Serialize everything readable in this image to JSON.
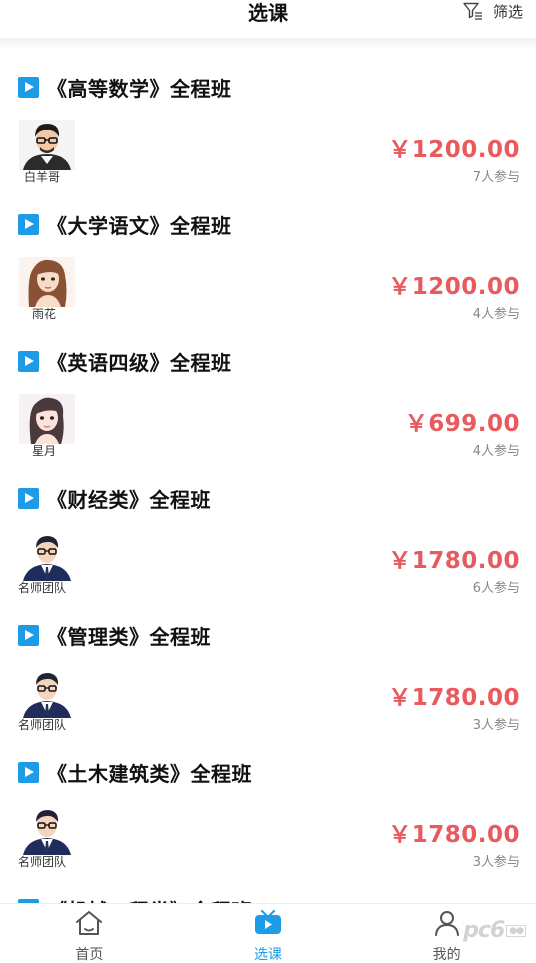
{
  "header": {
    "title": "选课",
    "filter_label": "筛选"
  },
  "courses": [
    {
      "name": "《高等数学》全程班",
      "teacher": "白羊哥",
      "price": "￥1200.00",
      "joined": "7人参与",
      "avatar": "man-glasses"
    },
    {
      "name": "《大学语文》全程班",
      "teacher": "雨花",
      "price": "￥1200.00",
      "joined": "4人参与",
      "avatar": "woman-brown-hair"
    },
    {
      "name": "《英语四级》全程班",
      "teacher": "星月",
      "price": "￥699.00",
      "joined": "4人参与",
      "avatar": "woman-dark-hair"
    },
    {
      "name": "《财经类》全程班",
      "teacher": "名师团队",
      "price": "￥1780.00",
      "joined": "6人参与",
      "avatar": "man-suit"
    },
    {
      "name": "《管理类》全程班",
      "teacher": "名师团队",
      "price": "￥1780.00",
      "joined": "3人参与",
      "avatar": "man-suit"
    },
    {
      "name": "《土木建筑类》全程班",
      "teacher": "名师团队",
      "price": "￥1780.00",
      "joined": "3人参与",
      "avatar": "man-suit"
    },
    {
      "name": "《机械工程类》全程班",
      "teacher": "",
      "price": "",
      "joined": "",
      "avatar": ""
    }
  ],
  "tabbar": {
    "items": [
      {
        "label": "首页",
        "icon": "home-icon"
      },
      {
        "label": "选课",
        "icon": "tv-icon",
        "active": true
      },
      {
        "label": "我的",
        "icon": "user-icon"
      }
    ]
  },
  "watermark": "pc6",
  "colors": {
    "accent": "#1e9be6",
    "price": "#e85a5e"
  }
}
